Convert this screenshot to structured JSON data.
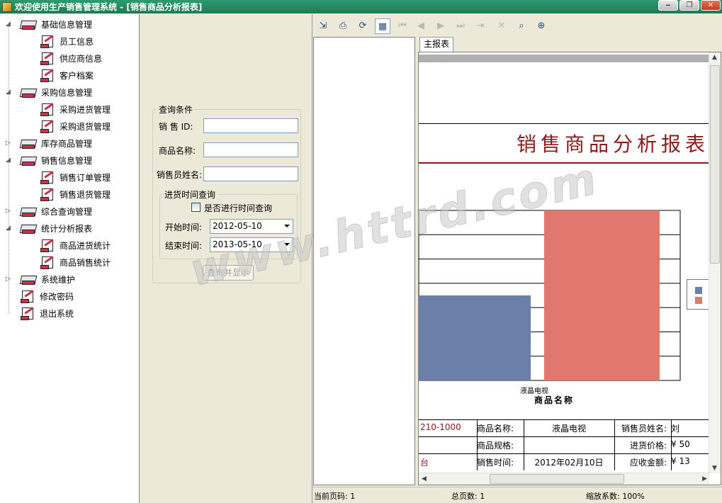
{
  "window": {
    "title": "欢迎使用生产销售管理系统 - [销售商品分析报表]",
    "minimize": "‒",
    "restore": "❐",
    "close": "✕"
  },
  "tree": {
    "items": [
      {
        "label": "基础信息管理",
        "level": 0,
        "icon": "folder-icon"
      },
      {
        "label": "员工信息",
        "level": 1,
        "icon": "doc-icon"
      },
      {
        "label": "供应商信息",
        "level": 1,
        "icon": "doc-icon"
      },
      {
        "label": "客户档案",
        "level": 1,
        "icon": "doc-icon"
      },
      {
        "label": "采购信息管理",
        "level": 0,
        "icon": "folder-icon"
      },
      {
        "label": "采购进货管理",
        "level": 1,
        "icon": "doc-icon"
      },
      {
        "label": "采购退货管理",
        "level": 1,
        "icon": "doc-icon"
      },
      {
        "label": "库存商品管理",
        "level": 0,
        "icon": "folder-icon"
      },
      {
        "label": "销售信息管理",
        "level": 0,
        "icon": "folder-icon"
      },
      {
        "label": "销售订单管理",
        "level": 1,
        "icon": "doc-icon"
      },
      {
        "label": "销售退货管理",
        "level": 1,
        "icon": "doc-icon"
      },
      {
        "label": "综合查询管理",
        "level": 0,
        "icon": "folder-icon"
      },
      {
        "label": "统计分析报表",
        "level": 0,
        "icon": "folder-icon"
      },
      {
        "label": "商品进货统计",
        "level": 1,
        "icon": "doc-icon"
      },
      {
        "label": "商品销售统计",
        "level": 1,
        "icon": "doc-icon"
      },
      {
        "label": "系统维护",
        "level": 0,
        "icon": "folder-icon"
      },
      {
        "label": "修改密码",
        "level": 0,
        "icon": "doc-icon"
      },
      {
        "label": "退出系统",
        "level": 0,
        "icon": "doc-icon"
      }
    ]
  },
  "query": {
    "group_title": "查询条件",
    "sale_id_label": "销 售 ID:",
    "sale_id_value": "",
    "product_name_label": "商品名称:",
    "product_name_value": "",
    "salesperson_label": "销售员姓名:",
    "salesperson_value": "",
    "time_group_title": "进货时间查询",
    "time_check_label": "是否进行时间查询",
    "time_check_checked": false,
    "start_label": "开始时间:",
    "start_value": "2012-05-10",
    "end_label": "结束时间:",
    "end_value": "2013-05-10",
    "submit_label": "查询并显示"
  },
  "viewer": {
    "tab_label": "主报表",
    "status_page": "当前页码: 1",
    "status_total": "总页数: 1",
    "status_zoom": "缩放系数: 100%",
    "toolbar_icons": [
      "export-icon",
      "print-icon",
      "refresh-icon",
      "group-tree-icon",
      "first-page-icon",
      "prev-page-icon",
      "next-page-icon",
      "last-page-icon",
      "goto-page-icon",
      "stop-icon",
      "search-icon",
      "zoom-icon"
    ]
  },
  "report": {
    "title": "销售商品分析报表",
    "category_label": "液晶电视",
    "axis_label": "商品名称",
    "rows": [
      {
        "c1": "210-1000",
        "c2": "商品名称:",
        "c3": "液晶电视",
        "c4": "销售员姓名:",
        "c5": "刘"
      },
      {
        "c1": "",
        "c2": "商品规格:",
        "c3": "",
        "c4": "进货价格:",
        "c5": "¥ 50"
      },
      {
        "c1": "台",
        "c2": "销售时间:",
        "c3": "2012年02月10日",
        "c4": "应收金额:",
        "c5": "¥ 13"
      }
    ]
  },
  "chart_data": {
    "type": "bar",
    "categories": [
      "液晶电视"
    ],
    "series": [
      {
        "name": "",
        "values": [
          3.5
        ],
        "color": "#6b7fa8"
      },
      {
        "name": "",
        "values": [
          7
        ],
        "color": "#e07870"
      }
    ],
    "xlabel": "商品名称",
    "ylabel": "",
    "ylim": [
      0,
      7
    ],
    "grid": true,
    "legend": "right"
  },
  "watermark": "www.httrd.com"
}
